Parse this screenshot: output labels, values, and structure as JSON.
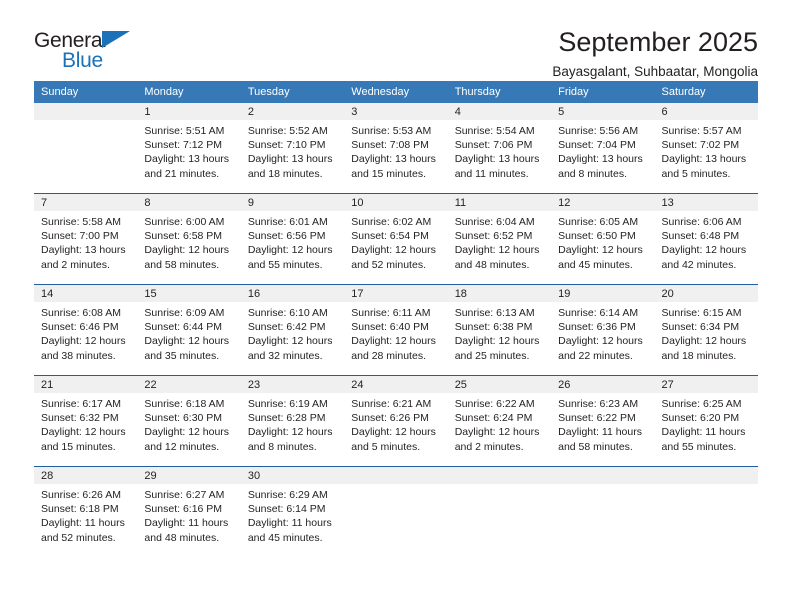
{
  "logo": {
    "word_one": "General",
    "word_two": "Blue",
    "triangle_icon": "triangle-icon",
    "accent_color": "#1b72b8"
  },
  "header": {
    "title": "September 2025",
    "subtitle": "Bayasgalant, Suhbaatar, Mongolia"
  },
  "theme": {
    "header_bg": "#3679b6",
    "week_divider": "#1f5fa0",
    "daynum_bg": "#f0f0f0",
    "text": "#231f20"
  },
  "calendar": {
    "weekday_headers": [
      "Sunday",
      "Monday",
      "Tuesday",
      "Wednesday",
      "Thursday",
      "Friday",
      "Saturday"
    ],
    "weeks": [
      [
        {
          "day": "",
          "lines": []
        },
        {
          "day": "1",
          "lines": [
            "Sunrise: 5:51 AM",
            "Sunset: 7:12 PM",
            "Daylight: 13 hours",
            "and 21 minutes."
          ]
        },
        {
          "day": "2",
          "lines": [
            "Sunrise: 5:52 AM",
            "Sunset: 7:10 PM",
            "Daylight: 13 hours",
            "and 18 minutes."
          ]
        },
        {
          "day": "3",
          "lines": [
            "Sunrise: 5:53 AM",
            "Sunset: 7:08 PM",
            "Daylight: 13 hours",
            "and 15 minutes."
          ]
        },
        {
          "day": "4",
          "lines": [
            "Sunrise: 5:54 AM",
            "Sunset: 7:06 PM",
            "Daylight: 13 hours",
            "and 11 minutes."
          ]
        },
        {
          "day": "5",
          "lines": [
            "Sunrise: 5:56 AM",
            "Sunset: 7:04 PM",
            "Daylight: 13 hours",
            "and 8 minutes."
          ]
        },
        {
          "day": "6",
          "lines": [
            "Sunrise: 5:57 AM",
            "Sunset: 7:02 PM",
            "Daylight: 13 hours",
            "and 5 minutes."
          ]
        }
      ],
      [
        {
          "day": "7",
          "lines": [
            "Sunrise: 5:58 AM",
            "Sunset: 7:00 PM",
            "Daylight: 13 hours",
            "and 2 minutes."
          ]
        },
        {
          "day": "8",
          "lines": [
            "Sunrise: 6:00 AM",
            "Sunset: 6:58 PM",
            "Daylight: 12 hours",
            "and 58 minutes."
          ]
        },
        {
          "day": "9",
          "lines": [
            "Sunrise: 6:01 AM",
            "Sunset: 6:56 PM",
            "Daylight: 12 hours",
            "and 55 minutes."
          ]
        },
        {
          "day": "10",
          "lines": [
            "Sunrise: 6:02 AM",
            "Sunset: 6:54 PM",
            "Daylight: 12 hours",
            "and 52 minutes."
          ]
        },
        {
          "day": "11",
          "lines": [
            "Sunrise: 6:04 AM",
            "Sunset: 6:52 PM",
            "Daylight: 12 hours",
            "and 48 minutes."
          ]
        },
        {
          "day": "12",
          "lines": [
            "Sunrise: 6:05 AM",
            "Sunset: 6:50 PM",
            "Daylight: 12 hours",
            "and 45 minutes."
          ]
        },
        {
          "day": "13",
          "lines": [
            "Sunrise: 6:06 AM",
            "Sunset: 6:48 PM",
            "Daylight: 12 hours",
            "and 42 minutes."
          ]
        }
      ],
      [
        {
          "day": "14",
          "lines": [
            "Sunrise: 6:08 AM",
            "Sunset: 6:46 PM",
            "Daylight: 12 hours",
            "and 38 minutes."
          ]
        },
        {
          "day": "15",
          "lines": [
            "Sunrise: 6:09 AM",
            "Sunset: 6:44 PM",
            "Daylight: 12 hours",
            "and 35 minutes."
          ]
        },
        {
          "day": "16",
          "lines": [
            "Sunrise: 6:10 AM",
            "Sunset: 6:42 PM",
            "Daylight: 12 hours",
            "and 32 minutes."
          ]
        },
        {
          "day": "17",
          "lines": [
            "Sunrise: 6:11 AM",
            "Sunset: 6:40 PM",
            "Daylight: 12 hours",
            "and 28 minutes."
          ]
        },
        {
          "day": "18",
          "lines": [
            "Sunrise: 6:13 AM",
            "Sunset: 6:38 PM",
            "Daylight: 12 hours",
            "and 25 minutes."
          ]
        },
        {
          "day": "19",
          "lines": [
            "Sunrise: 6:14 AM",
            "Sunset: 6:36 PM",
            "Daylight: 12 hours",
            "and 22 minutes."
          ]
        },
        {
          "day": "20",
          "lines": [
            "Sunrise: 6:15 AM",
            "Sunset: 6:34 PM",
            "Daylight: 12 hours",
            "and 18 minutes."
          ]
        }
      ],
      [
        {
          "day": "21",
          "lines": [
            "Sunrise: 6:17 AM",
            "Sunset: 6:32 PM",
            "Daylight: 12 hours",
            "and 15 minutes."
          ]
        },
        {
          "day": "22",
          "lines": [
            "Sunrise: 6:18 AM",
            "Sunset: 6:30 PM",
            "Daylight: 12 hours",
            "and 12 minutes."
          ]
        },
        {
          "day": "23",
          "lines": [
            "Sunrise: 6:19 AM",
            "Sunset: 6:28 PM",
            "Daylight: 12 hours",
            "and 8 minutes."
          ]
        },
        {
          "day": "24",
          "lines": [
            "Sunrise: 6:21 AM",
            "Sunset: 6:26 PM",
            "Daylight: 12 hours",
            "and 5 minutes."
          ]
        },
        {
          "day": "25",
          "lines": [
            "Sunrise: 6:22 AM",
            "Sunset: 6:24 PM",
            "Daylight: 12 hours",
            "and 2 minutes."
          ]
        },
        {
          "day": "26",
          "lines": [
            "Sunrise: 6:23 AM",
            "Sunset: 6:22 PM",
            "Daylight: 11 hours",
            "and 58 minutes."
          ]
        },
        {
          "day": "27",
          "lines": [
            "Sunrise: 6:25 AM",
            "Sunset: 6:20 PM",
            "Daylight: 11 hours",
            "and 55 minutes."
          ]
        }
      ],
      [
        {
          "day": "28",
          "lines": [
            "Sunrise: 6:26 AM",
            "Sunset: 6:18 PM",
            "Daylight: 11 hours",
            "and 52 minutes."
          ]
        },
        {
          "day": "29",
          "lines": [
            "Sunrise: 6:27 AM",
            "Sunset: 6:16 PM",
            "Daylight: 11 hours",
            "and 48 minutes."
          ]
        },
        {
          "day": "30",
          "lines": [
            "Sunrise: 6:29 AM",
            "Sunset: 6:14 PM",
            "Daylight: 11 hours",
            "and 45 minutes."
          ]
        },
        {
          "day": "",
          "lines": []
        },
        {
          "day": "",
          "lines": []
        },
        {
          "day": "",
          "lines": []
        },
        {
          "day": "",
          "lines": []
        }
      ]
    ]
  }
}
